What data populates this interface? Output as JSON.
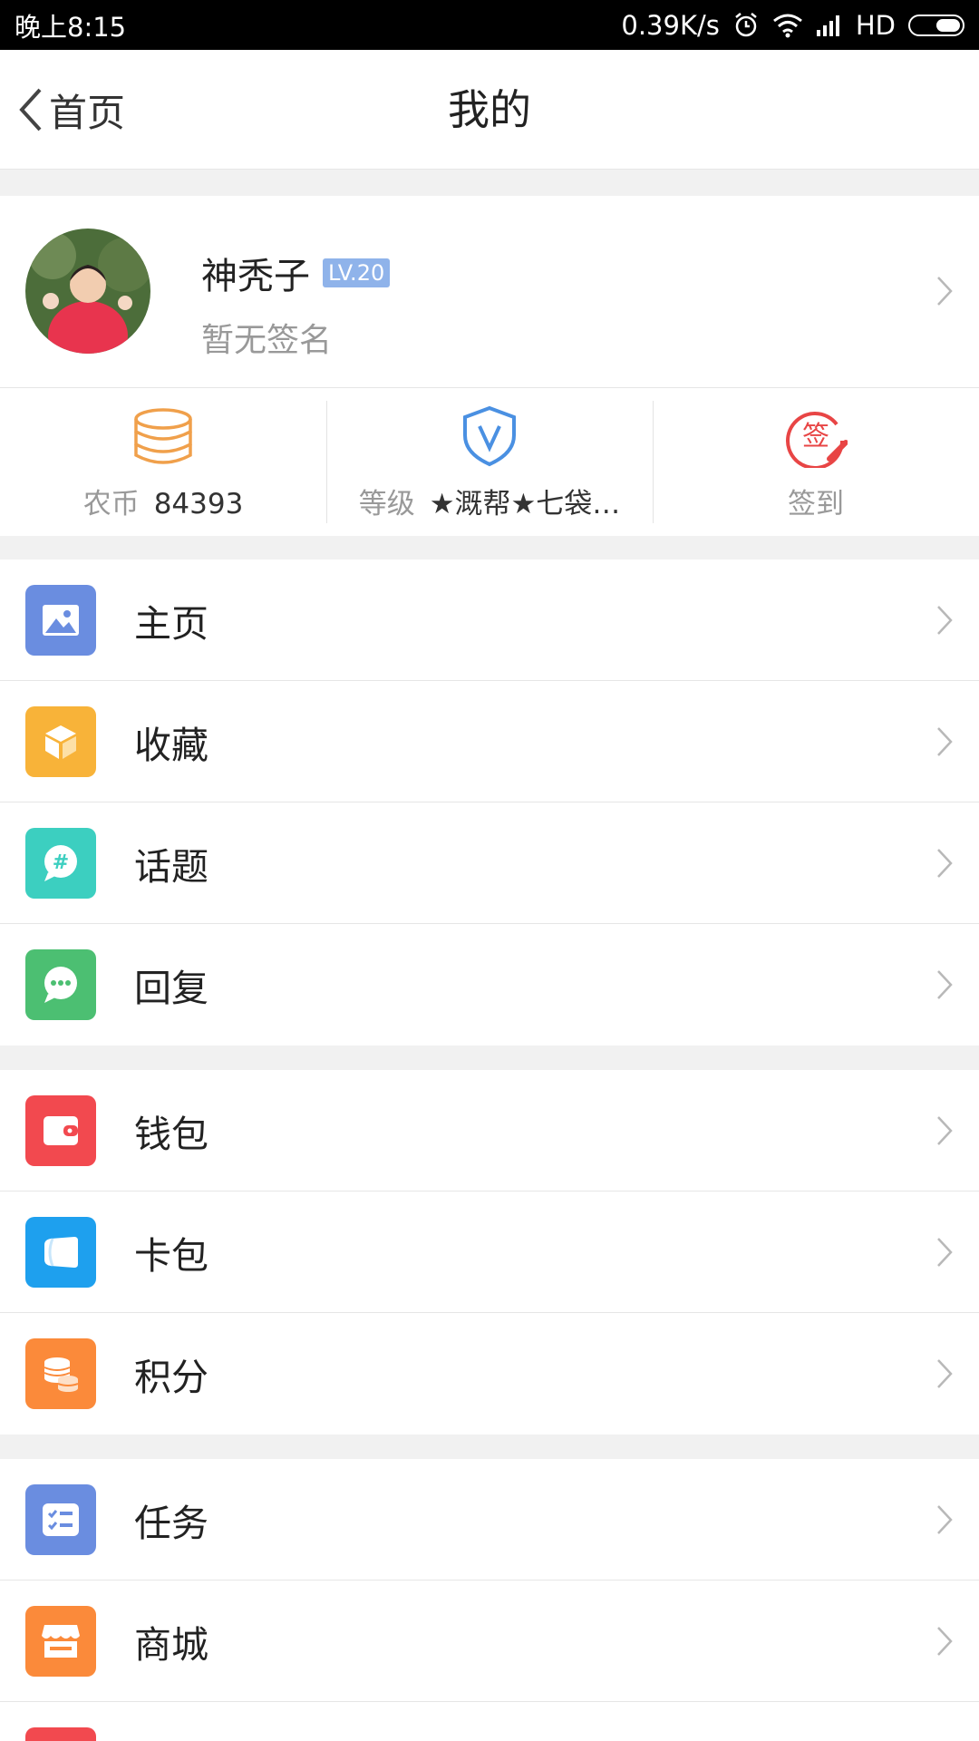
{
  "status_bar": {
    "time": "晚上8:15",
    "speed": "0.39K/s",
    "network": "HD"
  },
  "nav": {
    "back_label": "首页",
    "title": "我的"
  },
  "profile": {
    "name": "神秃子",
    "level_badge": "LV.20",
    "signature": "暂无签名"
  },
  "stats": [
    {
      "label": "农币",
      "value": "84393",
      "icon": "coins-stack-icon",
      "color": "#f0a04b"
    },
    {
      "label": "等级",
      "value": "★溉帮★七袋…",
      "icon": "shield-v-icon",
      "color": "#4a90e2"
    },
    {
      "label": "签到",
      "value": "",
      "icon": "sign-in-icon",
      "color": "#e84545"
    }
  ],
  "groups": [
    [
      {
        "label": "主页",
        "icon": "picture-icon",
        "color": "#6a8de0"
      },
      {
        "label": "收藏",
        "icon": "box-icon",
        "color": "#f8b339"
      },
      {
        "label": "话题",
        "icon": "hashtag-bubble-icon",
        "color": "#3ccfc0"
      },
      {
        "label": "回复",
        "icon": "chat-bubble-icon",
        "color": "#4cbf72"
      }
    ],
    [
      {
        "label": "钱包",
        "icon": "wallet-icon",
        "color": "#f2494f"
      },
      {
        "label": "卡包",
        "icon": "card-icon",
        "color": "#1ea0ee"
      },
      {
        "label": "积分",
        "icon": "points-coins-icon",
        "color": "#fb8a3a"
      }
    ],
    [
      {
        "label": "任务",
        "icon": "checklist-icon",
        "color": "#6a8de0"
      },
      {
        "label": "商城",
        "icon": "store-icon",
        "color": "#fb8a3a"
      },
      {
        "label": "",
        "icon": "more-icon",
        "color": "#f2494f"
      }
    ]
  ]
}
